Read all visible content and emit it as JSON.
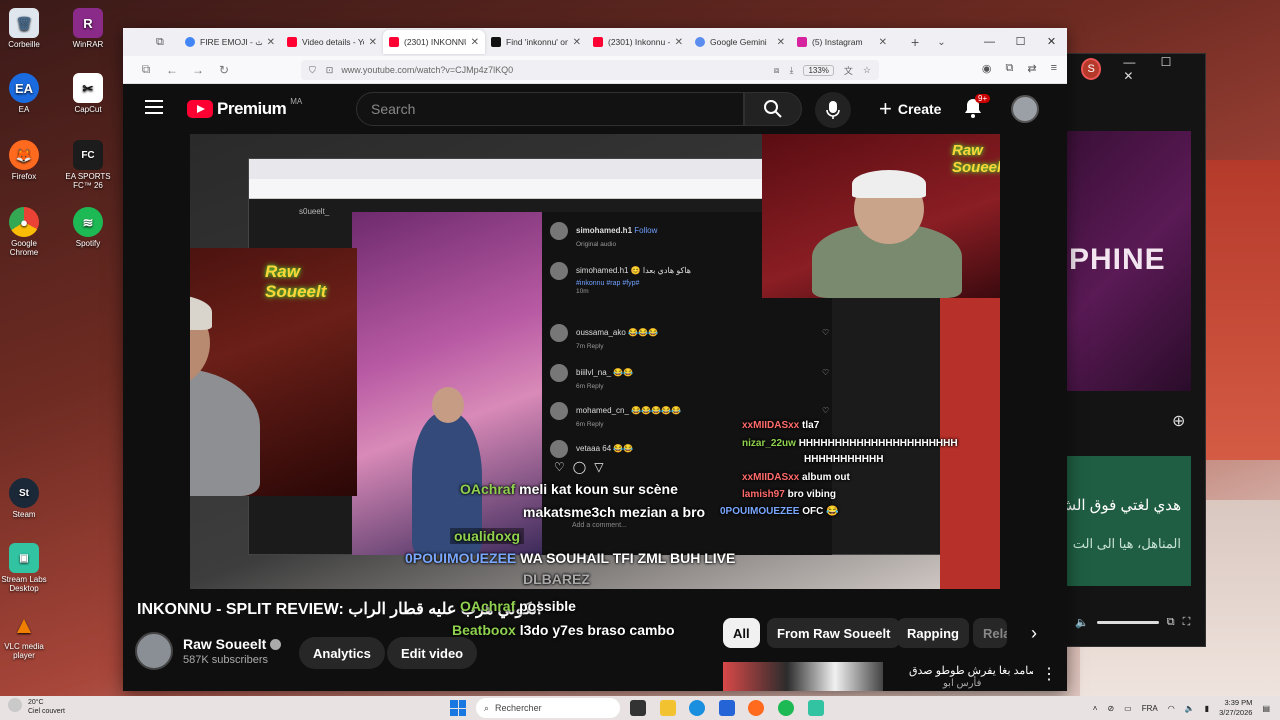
{
  "desktop": {
    "icons": [
      {
        "label": "Corbeille",
        "glyph": "🗑",
        "color": "#dfe6ee"
      },
      {
        "label": "WinRAR",
        "glyph": "R",
        "color": "#8a2b8a"
      },
      {
        "label": "EA",
        "glyph": "EA",
        "color": "#1a6be0"
      },
      {
        "label": "CapCut",
        "glyph": "C",
        "color": "#111111"
      },
      {
        "label": "Firefox",
        "glyph": "F",
        "color": "#ff6a1f"
      },
      {
        "label": "EA SPORTS FC™ 26",
        "glyph": "FC",
        "color": "#1c1c1c"
      },
      {
        "label": "Google Chrome",
        "glyph": "G",
        "color": "#2c8f3c"
      },
      {
        "label": "Spotify",
        "glyph": "S",
        "color": "#1db954"
      },
      {
        "label": "Steam",
        "glyph": "St",
        "color": "#1b2838"
      },
      {
        "label": "Stream Labs Desktop",
        "glyph": "SL",
        "color": "#31c3a2"
      },
      {
        "label": "VLC media player",
        "glyph": "▲",
        "color": "#f07f00"
      }
    ]
  },
  "browser": {
    "tabs": [
      {
        "title": "FIRE EMOJI - بحث",
        "favicon_color": "#4285f4",
        "active": false
      },
      {
        "title": "Video details - Yo",
        "favicon_color": "#ff0033",
        "active": false
      },
      {
        "title": "(2301) INKONNU",
        "favicon_color": "#ff0033",
        "active": true
      },
      {
        "title": "Find 'inkonnu' on",
        "favicon_color": "#111111",
        "active": false
      },
      {
        "title": "(2301) Inkonnu - !",
        "favicon_color": "#ff0033",
        "active": false
      },
      {
        "title": "Google Gemini",
        "favicon_color": "#5b8def",
        "active": false
      },
      {
        "title": "(5) Instagram",
        "favicon_color": "#d6249f",
        "active": false
      }
    ],
    "url": "www.youtube.com/watch?v=CJMp4z7lKQ0",
    "zoom": "133%"
  },
  "youtube": {
    "logo_word": "Premium",
    "region": "MA",
    "search_placeholder": "Search",
    "create_label": "Create",
    "notif_count": "9+",
    "video_title": "INKONNU - SPLIT REVIEW: انكوني هرب عليه قطار الراب",
    "channel_name": "Raw Soueelt",
    "subscribers": "587K subscribers",
    "analytics_label": "Analytics",
    "edit_label": "Edit video",
    "chips": [
      "All",
      "From Raw Soueelt",
      "Rapping",
      "Rela"
    ],
    "rec_title": "علي صامد بغا يفرش طوطو صدق",
    "rec_sub": "فأرس ابو"
  },
  "video": {
    "neon_left": "Raw Soueelt",
    "neon_right": "Raw Soueelt",
    "ig_user": "simohamed.h1",
    "ig_follow": "Follow",
    "ig_audio": "Original audio",
    "ig_comment_main": "simohamed.h1 😊 هاكو هادي بعدا",
    "ig_tags": "#inkonnu #rap #fyp#",
    "ig_time": "10m",
    "comments": [
      {
        "user": "oussama_ako 😂😂😂",
        "meta": "7m   Reply"
      },
      {
        "user": "biiilvl_na_ 😂😂",
        "meta": "6m   Reply"
      },
      {
        "user": "mohamed_cn_ 😂😂😂😂😂",
        "meta": "6m   Reply"
      },
      {
        "user": "vetaaa 64 😂😂",
        "meta": ""
      }
    ],
    "add_comment": "Add a comment...",
    "left_user": "s0ueelt_",
    "chat": [
      {
        "name": "xxMIIDASxx",
        "msg": "tla7"
      },
      {
        "name": "nizar_22uw",
        "msg": "HHHHHHHHHHHHHHHHHHHHHH"
      },
      {
        "name": "",
        "msg": "HHHHHHHHHHH"
      },
      {
        "name": "xxMIIDASxx",
        "msg": "album out"
      },
      {
        "name": "lamish97",
        "msg": "bro vibing"
      },
      {
        "name": "0POUIMOUEZEE",
        "msg": "OFC 😂"
      },
      {
        "name": "OAchraf",
        "msg": "meli kat koun sur scène"
      },
      {
        "name": "",
        "msg": "makatsme3ch mezian a bro"
      },
      {
        "name": "",
        "msg": "oualidoxg"
      },
      {
        "name": "0POUIMOUEZEE",
        "msg": "WA SOUHAIL TFI ZML BUH LIVE"
      },
      {
        "name": "",
        "msg": "DLBAREZ"
      },
      {
        "name": "OAchraf",
        "msg": "possible"
      },
      {
        "name": "Beatboox",
        "msg": "l3do y7es braso cambo"
      }
    ]
  },
  "bg_window": {
    "avatar": "S",
    "art_word": "PHINE",
    "card_line1": "هدي لغتي فوق الش",
    "card_line2": "المناهل، هيا الى الت"
  },
  "taskbar": {
    "temp": "20°C",
    "weather": "Ciel couvert",
    "search": "Rechercher",
    "lang": "FRA",
    "time": "3:39 PM",
    "date": "3/27/2026"
  }
}
